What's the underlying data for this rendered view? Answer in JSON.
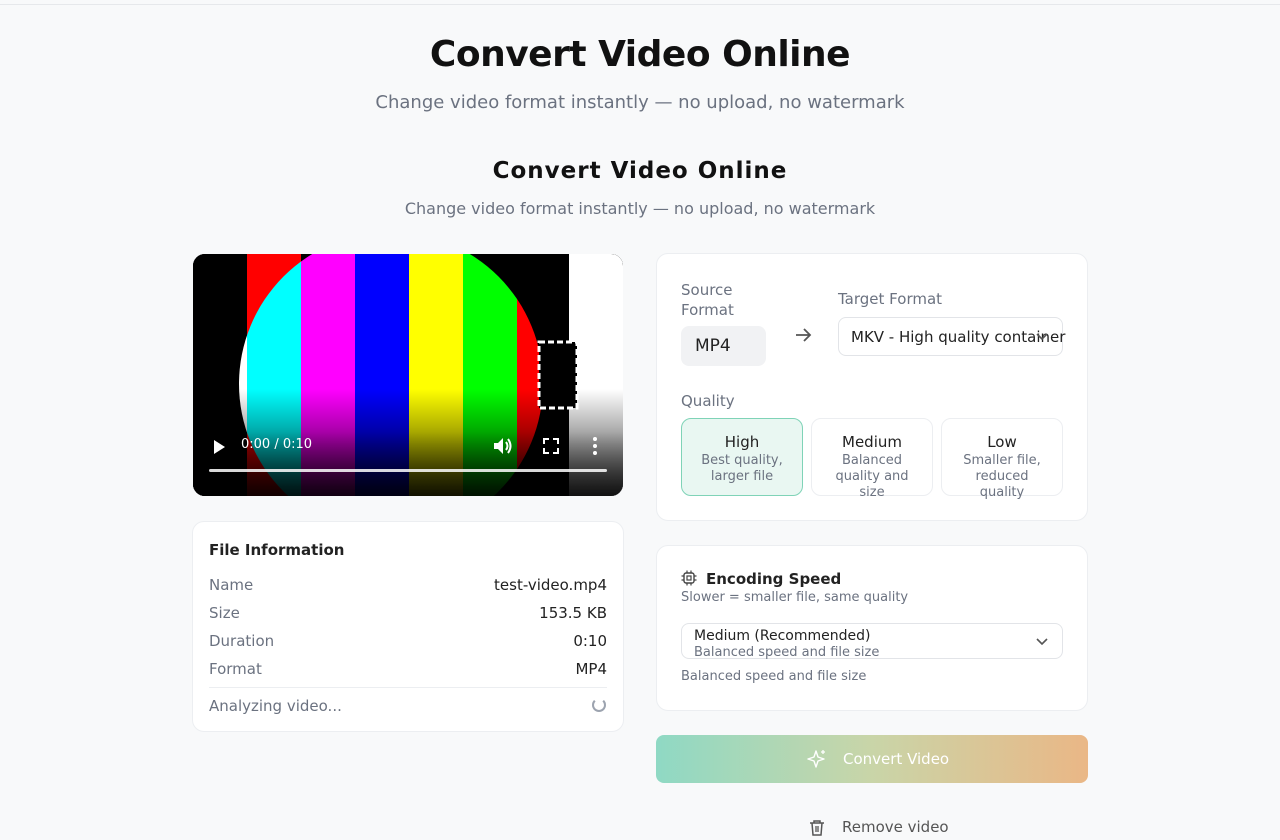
{
  "header": {
    "title": "Convert Video Online",
    "subtitle": "Change video format instantly — no upload, no watermark"
  },
  "section": {
    "title": "Convert Video Online",
    "subtitle": "Change video format instantly — no upload, no watermark"
  },
  "player": {
    "time": "0:00 / 0:10",
    "progress": 0,
    "icons": [
      "play-icon",
      "volume-icon",
      "fullscreen-icon",
      "more-options-icon"
    ]
  },
  "file_info": {
    "title": "File Information",
    "rows": [
      {
        "key": "Name",
        "value": "test-video.mp4"
      },
      {
        "key": "Size",
        "value": "153.5 KB"
      },
      {
        "key": "Duration",
        "value": "0:10"
      },
      {
        "key": "Format",
        "value": "MP4"
      }
    ],
    "status": "Analyzing video..."
  },
  "format": {
    "source_label": "Source Format",
    "source_value": "MP4",
    "target_label": "Target Format",
    "target_value": "MKV - High quality container",
    "quality_label": "Quality",
    "quality_options": [
      {
        "name": "High",
        "desc": "Best quality, larger file",
        "selected": true
      },
      {
        "name": "Medium",
        "desc": "Balanced quality and size",
        "selected": false
      },
      {
        "name": "Low",
        "desc": "Smaller file, reduced quality",
        "selected": false
      }
    ]
  },
  "encoding": {
    "title": "Encoding Speed",
    "subtitle": "Slower = smaller file, same quality",
    "selected": "Medium (Recommended)",
    "selected_desc": "Balanced speed and file size",
    "note": "Balanced speed and file size"
  },
  "actions": {
    "convert": "Convert Video",
    "remove": "Remove video"
  },
  "colors": {
    "accent_teal": "#7fd3b7",
    "accent_orange": "#eab786",
    "selected_bg": "#e9f7f2"
  }
}
